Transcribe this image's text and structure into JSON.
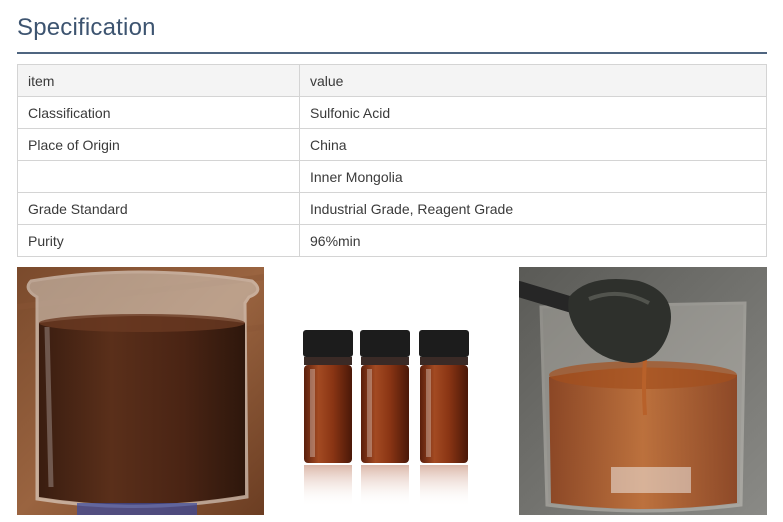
{
  "section": {
    "title": "Specification"
  },
  "table": {
    "headers": [
      "item",
      "value"
    ],
    "rows": [
      [
        "Classification",
        "Sulfonic Acid"
      ],
      [
        "Place of Origin",
        "China"
      ],
      [
        "",
        "Inner Mongolia"
      ],
      [
        "Grade Standard",
        "Industrial Grade, Reagent Grade"
      ],
      [
        "Purity",
        "96%min"
      ]
    ]
  },
  "images": [
    {
      "name": "beaker-of-brown-liquid-photo"
    },
    {
      "name": "three-amber-vials-photo"
    },
    {
      "name": "spatula-dripping-liquid-photo"
    }
  ],
  "colors": {
    "title": "#3d5470",
    "rule": "#4f6580",
    "header_bg": "#f4f4f4",
    "border": "#d4d4d4"
  }
}
